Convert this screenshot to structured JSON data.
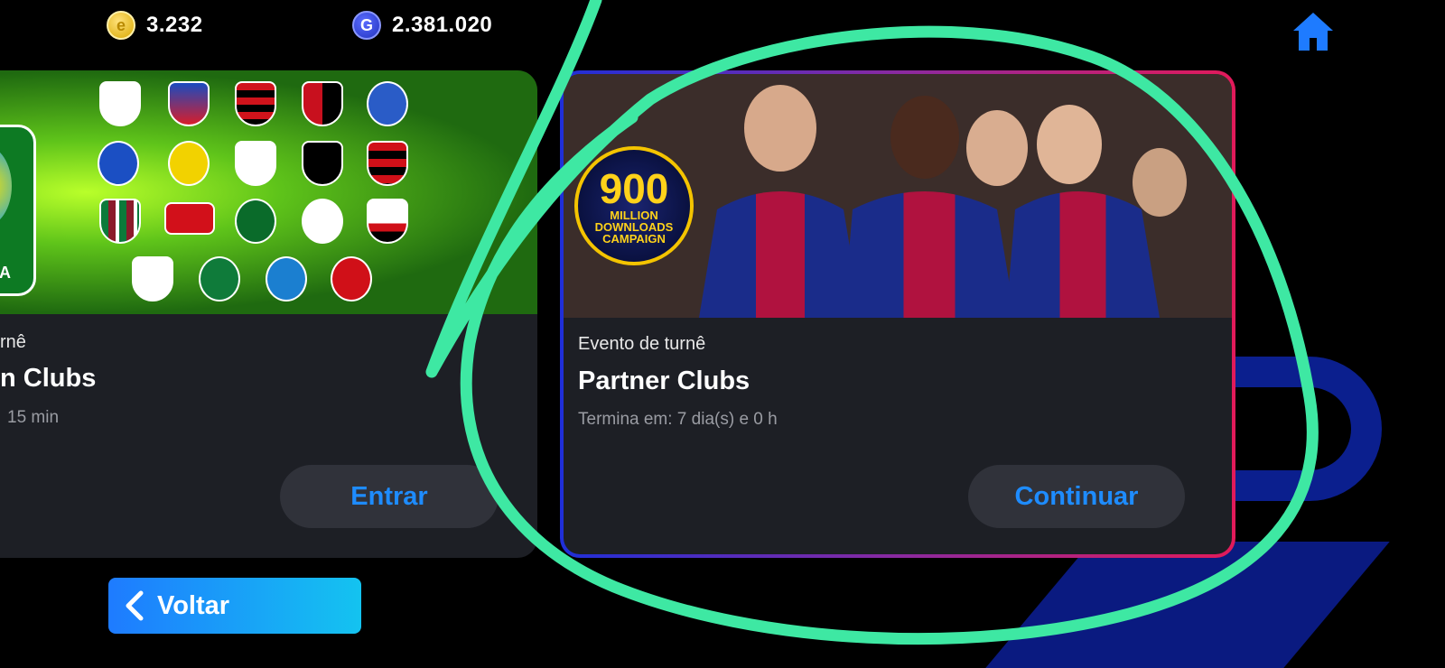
{
  "currencies": {
    "coins": {
      "value": "3.232",
      "icon": "gold-coin-icon",
      "glyph": "e"
    },
    "gp": {
      "value": "2.381.020",
      "icon": "gp-coin-icon",
      "glyph": "G"
    }
  },
  "home": {
    "icon": "home-icon",
    "color": "#1e7bff"
  },
  "cards": [
    {
      "label": "rnê",
      "title": "n Clubs",
      "time": "15 min",
      "button": "Entrar",
      "banner": "brazilian-clubs-banner",
      "badge_text": "IRA"
    },
    {
      "label": "Evento de turnê",
      "title": "Partner Clubs",
      "time": "Termina em: 7 dia(s) e 0 h",
      "button": "Continuar",
      "banner": "partner-clubs-banner",
      "campaign_badge": {
        "number": "900",
        "text": "MILLION DOWNLOADS CAMPAIGN"
      }
    }
  ],
  "back_button": {
    "label": "Voltar",
    "icon": "chevron-left-icon"
  },
  "annotation": {
    "color": "#3ee8a3",
    "shape": "hand-drawn-circle"
  },
  "colors": {
    "accent": "#1e8cff",
    "card_bg": "#1d1f25",
    "button_bg": "#30323a"
  }
}
